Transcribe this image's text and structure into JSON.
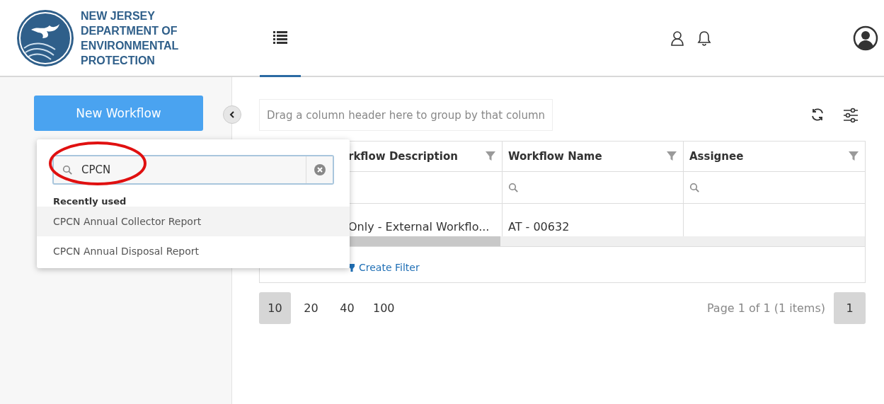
{
  "header": {
    "logo_lines": [
      "NEW JERSEY",
      "DEPARTMENT OF",
      "ENVIRONMENTAL",
      "PROTECTION"
    ],
    "nav_tabs": [
      {
        "kind": "list",
        "selected": true
      }
    ]
  },
  "sidebar": {
    "new_button": "New Workflow"
  },
  "dropdown": {
    "search_value": "CPCN",
    "section_title": "Recently used",
    "items": [
      {
        "label": "CPCN Annual Collector Report",
        "selected": true
      },
      {
        "label": "CPCN Annual Disposal Report",
        "selected": false
      }
    ]
  },
  "grid": {
    "group_panel": "Drag a column header here to group by that column",
    "columns": [
      {
        "label": "rkflow Description"
      },
      {
        "label": "Workflow Name"
      },
      {
        "label": "Assignee"
      }
    ],
    "rows": [
      [
        "Only - External Workflo...",
        "AT - 00632",
        null
      ]
    ],
    "create_filter": "Create Filter"
  },
  "pager": {
    "sizes": [
      {
        "label": "10",
        "selected": true
      },
      {
        "label": "20",
        "selected": false
      },
      {
        "label": "40",
        "selected": false
      },
      {
        "label": "100",
        "selected": false
      }
    ],
    "info": "Page 1 of 1 (1 items)",
    "pages": [
      {
        "label": "1",
        "selected": true
      }
    ]
  }
}
